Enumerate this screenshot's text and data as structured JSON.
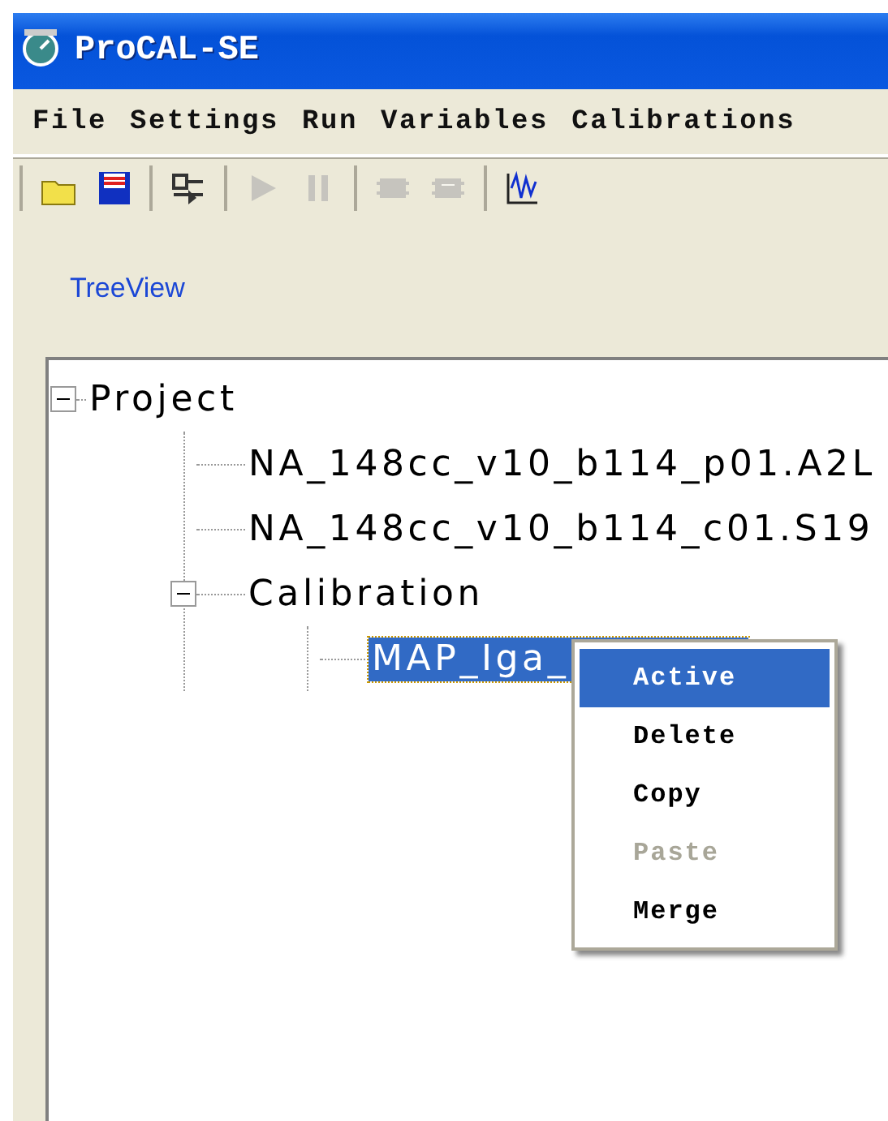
{
  "window": {
    "title": "ProCAL-SE"
  },
  "menu_bar": [
    "File",
    "Settings",
    "Run",
    "Variables",
    "Calibrations"
  ],
  "toolbar": [
    [
      {
        "kind": "open",
        "disabled": false
      },
      {
        "kind": "save",
        "disabled": false
      }
    ],
    [
      {
        "kind": "connect",
        "disabled": false
      }
    ],
    [
      {
        "kind": "play",
        "disabled": true
      },
      {
        "kind": "pause",
        "disabled": true
      }
    ],
    [
      {
        "kind": "upload",
        "disabled": true
      },
      {
        "kind": "download",
        "disabled": true
      }
    ],
    [
      {
        "kind": "wave",
        "disabled": false
      }
    ]
  ],
  "view_link": "TreeView",
  "tree": [
    {
      "label": "Project",
      "expanded": true,
      "selected": false,
      "children": [
        {
          "label": "NA_148cc_v10_b114_p01.A2L",
          "selected": false
        },
        {
          "label": "NA_148cc_v10_b114_c01.S19",
          "selected": false
        },
        {
          "label": "Calibration",
          "expanded": true,
          "selected": false,
          "children": [
            {
              "label": "MAP_Iga_",
              "selected": true
            }
          ]
        }
      ]
    }
  ],
  "context_menu": [
    {
      "label": "Active",
      "selected": true,
      "disabled": false
    },
    {
      "label": "Delete",
      "selected": false,
      "disabled": false
    },
    {
      "label": "Copy",
      "selected": false,
      "disabled": false
    },
    {
      "label": "Paste",
      "selected": false,
      "disabled": true
    },
    {
      "label": "Merge",
      "selected": false,
      "disabled": false
    }
  ]
}
